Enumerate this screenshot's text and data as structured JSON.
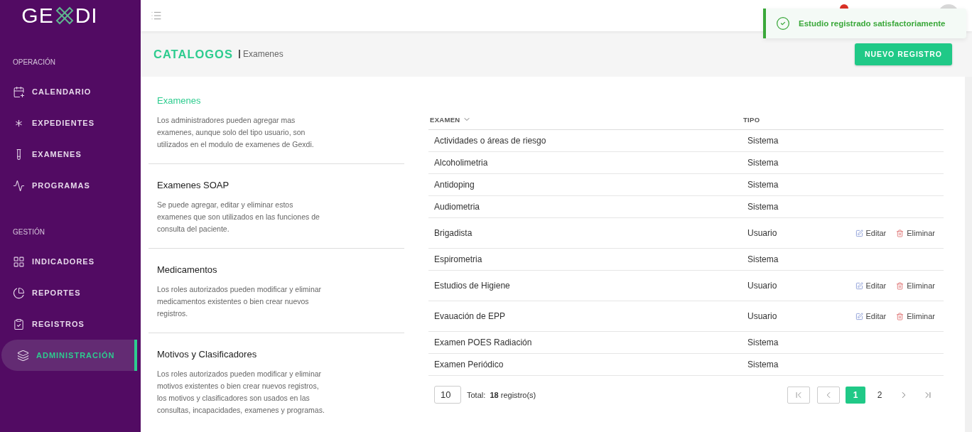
{
  "logo": {
    "left": "GE",
    "right": "DI"
  },
  "sidebar": {
    "sections": [
      {
        "title": "OPERACIÓN",
        "items": [
          {
            "label": "CALENDARIO",
            "selected": false
          },
          {
            "label": "EXPEDIENTES",
            "selected": false
          },
          {
            "label": "EXAMENES",
            "selected": false
          },
          {
            "label": "PROGRAMAS",
            "selected": false
          }
        ]
      },
      {
        "title": "GESTIÓN",
        "items": [
          {
            "label": "INDICADORES",
            "selected": false
          },
          {
            "label": "REPORTES",
            "selected": false
          },
          {
            "label": "REGISTROS",
            "selected": false
          },
          {
            "label": "ADMINISTRACIÓN",
            "selected": true
          }
        ]
      }
    ]
  },
  "toast": {
    "message": "Estudio registrado satisfactoriamente"
  },
  "page_header": {
    "title": "CATALOGOS",
    "subtitle": "Examenes",
    "button": "NUEVO REGISTRO"
  },
  "catalogs": [
    {
      "title": "Examenes",
      "selected": true,
      "description": "Los administradores pueden agregar mas examenes, aunque solo del tipo usuario, son utilizados en el modulo de examenes de Gexdi."
    },
    {
      "title": "Examenes SOAP",
      "selected": false,
      "description": "Se puede agregar, editar y eliminar estos examenes que son utilizados en las funciones de consulta del paciente."
    },
    {
      "title": "Medicamentos",
      "selected": false,
      "description": "Los roles autorizados pueden modificar y eliminar medicamentos existentes o bien crear nuevos registros."
    },
    {
      "title": "Motivos y Clasificadores",
      "selected": false,
      "description": "Los roles autorizados pueden modificar y eliminar motivos existentes o bien crear nuevos registros, los motivos y clasificadores son usados en las consultas, incapacidades, examenes y programas."
    }
  ],
  "table": {
    "columns": [
      "EXAMEN",
      "TIPO"
    ],
    "rows": [
      {
        "examen": "Actividades o áreas de riesgo",
        "tipo": "Sistema"
      },
      {
        "examen": "Alcoholimetria",
        "tipo": "Sistema"
      },
      {
        "examen": "Antidoping",
        "tipo": "Sistema"
      },
      {
        "examen": "Audiometria",
        "tipo": "Sistema"
      },
      {
        "examen": "Brigadista",
        "tipo": "Usuario",
        "actions": [
          "Editar",
          "Eliminar"
        ]
      },
      {
        "examen": "Espirometria",
        "tipo": "Sistema"
      },
      {
        "examen": "Estudios de Higiene",
        "tipo": "Usuario",
        "actions": [
          "Editar",
          "Eliminar"
        ]
      },
      {
        "examen": "Evauación de EPP",
        "tipo": "Usuario",
        "actions": [
          "Editar",
          "Eliminar"
        ]
      },
      {
        "examen": "Examen POES Radiación",
        "tipo": "Sistema"
      },
      {
        "examen": "Examen Periódico",
        "tipo": "Sistema"
      }
    ]
  },
  "pagination": {
    "page_size": "10",
    "total_label": "Total:",
    "total": "18",
    "total_unit": "registro(s)",
    "pages": [
      {
        "label": "1",
        "selected": true
      },
      {
        "label": "2",
        "selected": false
      }
    ]
  }
}
